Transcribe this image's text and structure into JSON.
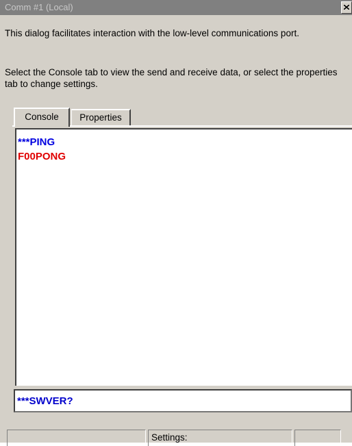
{
  "window": {
    "title": "Comm #1 (Local)"
  },
  "description": {
    "line1": "This dialog facilitates interaction with the low-level communications port.",
    "line2": "Select the Console tab to view the send and receive data, or select the properties tab to change settings."
  },
  "tabs": [
    {
      "label": "Console",
      "selected": true
    },
    {
      "label": "Properties",
      "selected": false
    }
  ],
  "console": {
    "lines": [
      {
        "text": "***PING",
        "color": "#0000e0"
      },
      {
        "text": "F00PONG",
        "color": "#e00000"
      }
    ]
  },
  "command_input": {
    "value": "***SWVER?"
  },
  "statusbar": {
    "pane1": "",
    "settings_label": "Settings:",
    "pane3": ""
  },
  "colors": {
    "sent": "#0000e0",
    "received": "#e00000",
    "face": "#d4d0c8"
  }
}
